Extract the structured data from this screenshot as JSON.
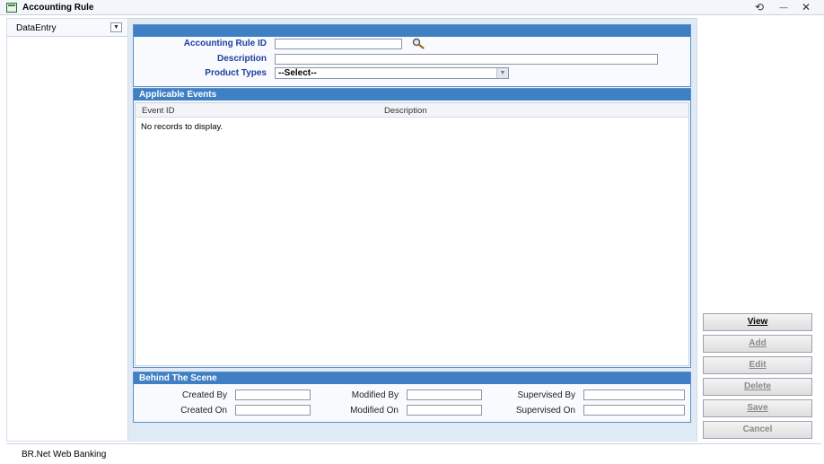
{
  "window": {
    "title": "Accounting Rule",
    "icon": "form-icon"
  },
  "window_controls": {
    "refresh": "⟲",
    "minimize": "—",
    "close": "✕"
  },
  "left_pane": {
    "dropdown_value": "DataEntry",
    "dropdown_icon": "chevron-down-icon"
  },
  "form": {
    "accounting_rule_id_label": "Accounting Rule ID",
    "accounting_rule_id_value": "",
    "description_label": "Description",
    "description_value": "",
    "product_types_label": "Product Types",
    "product_types_value": "--Select--"
  },
  "events": {
    "title": "Applicable Events",
    "columns": [
      "Event ID",
      "Description"
    ],
    "rows": [],
    "empty_text": "No records to display."
  },
  "behind_scene": {
    "title": "Behind The Scene",
    "created_by_label": "Created By",
    "created_by_value": "",
    "created_on_label": "Created On",
    "created_on_value": "",
    "modified_by_label": "Modified By",
    "modified_by_value": "",
    "modified_on_label": "Modified On",
    "modified_on_value": "",
    "supervised_by_label": "Supervised By",
    "supervised_by_value": "",
    "supervised_on_label": "Supervised On",
    "supervised_on_value": ""
  },
  "actions": {
    "view": "View",
    "add": "Add",
    "edit": "Edit",
    "delete": "Delete",
    "save": "Save",
    "cancel": "Cancel"
  },
  "status_bar": {
    "text": "BR.Net Web Banking"
  },
  "colors": {
    "header_blue": "#3f7fc3",
    "label_blue": "#1f3fa0",
    "panel_bg": "#dfeaf5"
  }
}
